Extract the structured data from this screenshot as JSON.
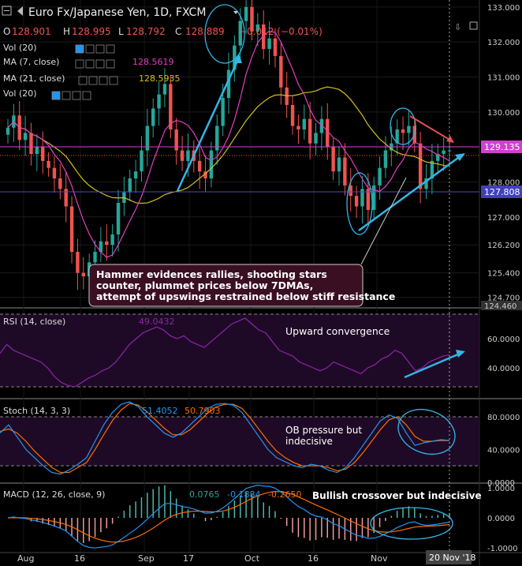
{
  "header": {
    "symbol": "Euro Fx/Japanese Yen, 1D, FXCM",
    "o_label": "O",
    "o_val": "128.901",
    "h_label": "H",
    "h_val": "128.995",
    "l_label": "L",
    "l_val": "128.792",
    "c_label": "C",
    "c_val": "128.889",
    "change": "−0.012 (−0.01%)"
  },
  "legend": {
    "vol1": "Vol (20)",
    "ma7": "MA (7, close)",
    "ma7_val": "128.5619",
    "ma21": "MA (21, close)",
    "ma21_val": "128.5935",
    "vol2": "Vol (20)"
  },
  "colors": {
    "up": "#26a69a",
    "down": "#ef5350",
    "ma7": "#e040c0",
    "ma21": "#d4c020",
    "annot": "#33b5e5",
    "arrow_red": "#e05050",
    "resistance": "#d040d0",
    "support": "#4a4acc",
    "rsi": "#8e24aa",
    "stoch_k": "#2196f3",
    "stoch_d": "#ff6d00",
    "macd": "#2196f3",
    "signal": "#ff6d00"
  },
  "annotation_main": "Hammer evidences rallies, shooting stars counter, plummet prices below 7DMAs, attempt of upswings restrained below stiff resistance",
  "annotation_rsi": "Upward convergence",
  "annotation_stoch": "OB pressure but indecisive",
  "annotation_macd": "Bullish crossover but indecisive",
  "price_labels": {
    "resistance": "129.135",
    "support": "127.808",
    "bottom": "124.460"
  },
  "rsi_legend": {
    "label": "RSI (14, close)",
    "value": "49.0432"
  },
  "stoch_legend": {
    "label": "Stoch (14, 3, 3)",
    "k": "51.4052",
    "d": "50.7903"
  },
  "macd_legend": {
    "label": "MACD (12, 26, close, 9)",
    "hist": "0.0765",
    "macd": "-0.1884",
    "signal": "-0.2650"
  },
  "date_label": "20 Nov '18",
  "chart_data": [
    {
      "type": "candlestick",
      "title": "Euro Fx/Japanese Yen, 1D, FXCM",
      "ylim": [
        124.4,
        133.2
      ],
      "y_ticks": [
        "133.000",
        "132.000",
        "131.000",
        "130.000",
        "129.000",
        "128.000",
        "127.000",
        "126.200",
        "125.400",
        "124.700"
      ],
      "x_ticks": [
        "Aug",
        "16",
        "Sep",
        "17",
        "Oct",
        "16",
        "Nov"
      ],
      "closes": [
        129.55,
        129.9,
        129.2,
        129.4,
        128.8,
        129.0,
        128.6,
        128.4,
        128.1,
        127.8,
        127.3,
        126.0,
        125.4,
        125.3,
        125.7,
        126.0,
        126.3,
        126.2,
        126.5,
        127.4,
        127.7,
        128.1,
        128.3,
        128.9,
        129.6,
        130.1,
        130.5,
        130.8,
        129.5,
        128.9,
        128.6,
        128.9,
        128.6,
        128.3,
        128.1,
        128.9,
        129.6,
        130.4,
        131.2,
        131.9,
        132.6,
        133.0,
        132.3,
        132.5,
        131.8,
        132.1,
        131.6,
        130.7,
        130.2,
        129.6,
        129.5,
        129.8,
        129.1,
        129.4,
        129.8,
        129.0,
        128.3,
        128.7,
        127.9,
        127.6,
        127.3,
        127.8,
        127.2,
        127.9,
        128.4,
        128.9,
        129.1,
        129.5,
        129.4,
        129.6,
        129.1,
        127.8,
        128.1,
        128.6,
        128.8,
        128.9,
        128.9
      ],
      "series": [
        {
          "name": "MA (7, close)",
          "last": 128.5619
        },
        {
          "name": "MA (21, close)",
          "last": 128.5935
        }
      ]
    },
    {
      "type": "line",
      "title": "RSI (14, close)",
      "ylim": [
        20,
        80
      ],
      "y_ticks": [
        "60.0000",
        "40.0000"
      ],
      "values": [
        50,
        56,
        52,
        50,
        48,
        46,
        44,
        40,
        34,
        30,
        28,
        27,
        30,
        33,
        35,
        38,
        40,
        44,
        50,
        56,
        60,
        64,
        66,
        68,
        66,
        62,
        60,
        62,
        58,
        56,
        54,
        58,
        62,
        66,
        70,
        72,
        74,
        70,
        66,
        64,
        58,
        52,
        50,
        48,
        44,
        42,
        40,
        38,
        40,
        44,
        42,
        40,
        38,
        36,
        40,
        42,
        46,
        48,
        52,
        50,
        44,
        38,
        40,
        44,
        46,
        48,
        49
      ]
    },
    {
      "type": "line",
      "title": "Stoch (14, 3, 3)",
      "ylim": [
        0,
        100
      ],
      "y_ticks": [
        "80.0000",
        "40.0000",
        "0.0000"
      ],
      "series": [
        {
          "name": "%K",
          "values": [
            60,
            70,
            55,
            40,
            30,
            20,
            12,
            10,
            15,
            22,
            30,
            50,
            70,
            85,
            95,
            98,
            92,
            80,
            70,
            60,
            55,
            60,
            70,
            80,
            90,
            95,
            96,
            94,
            85,
            70,
            55,
            40,
            30,
            25,
            20,
            18,
            22,
            20,
            15,
            12,
            18,
            30,
            45,
            60,
            75,
            82,
            78,
            60,
            45,
            48,
            50,
            52,
            51
          ]
        },
        {
          "name": "%D",
          "values": [
            62,
            65,
            60,
            50,
            38,
            28,
            18,
            12,
            12,
            18,
            24,
            40,
            58,
            75,
            88,
            96,
            94,
            86,
            76,
            66,
            58,
            58,
            64,
            74,
            84,
            92,
            95,
            95,
            90,
            78,
            64,
            50,
            38,
            30,
            24,
            20,
            20,
            20,
            18,
            14,
            16,
            24,
            36,
            50,
            64,
            76,
            80,
            70,
            56,
            50,
            50,
            51,
            50.8
          ]
        }
      ]
    },
    {
      "type": "line",
      "title": "MACD (12, 26, close, 9)",
      "ylim": [
        -1.1,
        1.1
      ],
      "y_ticks": [
        "1.0000",
        "0.0000",
        "-1.0000"
      ],
      "series": [
        {
          "name": "MACD",
          "last": -0.1884
        },
        {
          "name": "Signal",
          "last": -0.265
        },
        {
          "name": "Histogram",
          "last": 0.0765
        }
      ]
    }
  ]
}
